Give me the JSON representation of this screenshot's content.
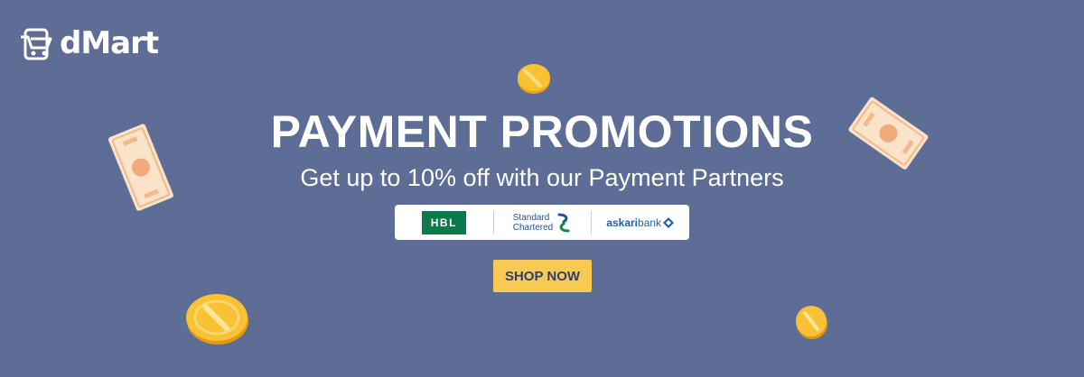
{
  "brand": {
    "name": "dMart"
  },
  "headline": "PAYMENT PROMOTIONS",
  "subheadline": "Get up to 10% off with our Payment Partners",
  "partners": {
    "hbl": "HBL",
    "standard_chartered_line1": "Standard",
    "standard_chartered_line2": "Chartered",
    "askari_part1": "askari",
    "askari_part2": "bank"
  },
  "cta": {
    "label": "SHOP NOW"
  },
  "icons": [
    "cart-icon",
    "coin-icon",
    "banknote-icon",
    "standard-chartered-icon",
    "askari-bank-icon"
  ],
  "colors": {
    "background": "#5d6d96",
    "button": "#f7c955",
    "button_text": "#2f3f6b",
    "hbl_green": "#0b7a4b",
    "partner_blue": "#1f4fa3"
  }
}
